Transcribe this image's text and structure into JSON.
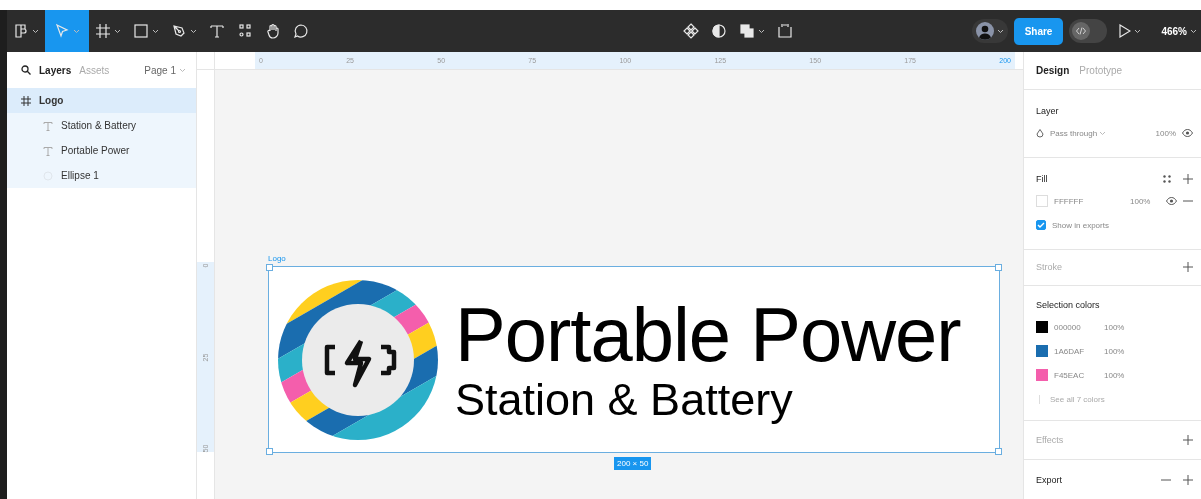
{
  "toolbar": {
    "left_tools": [
      {
        "kind": "main-menu",
        "menu": true,
        "selected": false
      },
      {
        "kind": "move",
        "menu": true,
        "selected": true
      },
      {
        "kind": "frame",
        "menu": true,
        "selected": false
      },
      {
        "kind": "shape",
        "menu": true,
        "selected": false
      },
      {
        "kind": "pen",
        "menu": true,
        "selected": false
      },
      {
        "kind": "text",
        "menu": false,
        "selected": false
      },
      {
        "kind": "resources",
        "menu": false,
        "selected": false
      },
      {
        "kind": "hand",
        "menu": false,
        "selected": false
      },
      {
        "kind": "comment",
        "menu": false,
        "selected": false
      }
    ],
    "center_tools": [
      {
        "kind": "component",
        "menu": false
      },
      {
        "kind": "mask",
        "menu": false
      },
      {
        "kind": "boolean",
        "menu": true
      },
      {
        "kind": "crop",
        "menu": false
      }
    ],
    "share_label": "Share",
    "dev_mode": false,
    "zoom": "466%"
  },
  "layers_panel": {
    "tabs": [
      {
        "label": "Layers",
        "selected": true
      },
      {
        "label": "Assets",
        "selected": false
      }
    ],
    "page": "Page 1",
    "layers": [
      {
        "name": "Logo",
        "kind": "frame",
        "selected": true,
        "children": [
          {
            "name": "Station & Battery",
            "kind": "text",
            "selected": false
          },
          {
            "name": "Portable Power",
            "kind": "text",
            "selected": false
          },
          {
            "name": "Ellipse 1",
            "kind": "ellipse",
            "selected": false
          }
        ]
      }
    ]
  },
  "rulers": {
    "horizontal": [
      "0",
      "25",
      "50",
      "75",
      "100",
      "125",
      "150",
      "175",
      "200"
    ],
    "vertical": [
      "0",
      "25",
      "50"
    ]
  },
  "canvas": {
    "frame": {
      "name": "Logo",
      "size": "200 × 50",
      "selected": true,
      "title": "Portable Power",
      "subtitle": "Station & Battery"
    }
  },
  "design_panel": {
    "tabs": [
      {
        "label": "Design",
        "selected": true
      },
      {
        "label": "Prototype",
        "selected": false
      }
    ],
    "layer": {
      "heading": "Layer",
      "blend": "Pass through",
      "opacity": "100%"
    },
    "fill": {
      "heading": "Fill",
      "hex": "FFFFFF",
      "opacity": "100%",
      "color": "#ffffff",
      "show_in_exports": {
        "label": "Show in exports",
        "checked": true
      }
    },
    "stroke": {
      "heading": "Stroke"
    },
    "selection_colors": {
      "heading": "Selection colors",
      "colors": [
        {
          "hex": "000000",
          "opacity": "100%",
          "color": "#000000"
        },
        {
          "hex": "1A6DAF",
          "opacity": "100%",
          "color": "#1a6daf"
        },
        {
          "hex": "F45EAC",
          "opacity": "100%",
          "color": "#f45eac"
        }
      ],
      "see_all": "See all 7 colors"
    },
    "effects": {
      "heading": "Effects"
    },
    "export": {
      "heading": "Export"
    }
  }
}
